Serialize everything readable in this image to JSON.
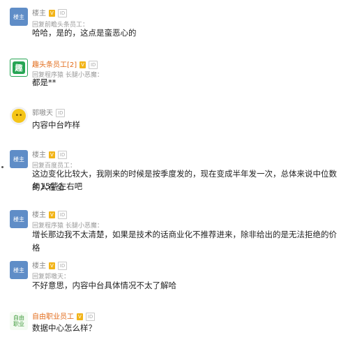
{
  "comments": [
    {
      "avatar_text": "楼主",
      "username": "楼主",
      "badge_v": "V",
      "badge_id": "ID",
      "reply": "回复前瞻头条员工：",
      "content": "哈哈，是的，这点是蛮恶心的"
    },
    {
      "avatar_text": "趣",
      "username": "趣头条员工[2]",
      "badge_v": "V",
      "badge_id": "ID",
      "reply": "回复程序猿 长腿小恶魔：",
      "content": "都是**"
    },
    {
      "avatar_text": "••",
      "username": "郭嗷天",
      "badge_id": "ID",
      "content": "内容中台咋样"
    },
    {
      "avatar_text": "楼主",
      "username": "楼主",
      "badge_v": "V",
      "badge_id": "ID",
      "reply": "回复百度员工：",
      "content_line1": "这边变化比较大，我刚来的时候是按季度发的，现在变成半年发一次，总体来说中位数的人在全",
      "content_line2": "年15薪左右吧"
    },
    {
      "avatar_text": "楼主",
      "username": "楼主",
      "badge_v": "V",
      "badge_id": "ID",
      "reply": "回复程序猿 长腿小恶魔：",
      "content": "增长那边我不太清楚，如果是技术的话商业化不推荐进来，除非给出的是无法拒绝的价格"
    },
    {
      "avatar_text": "楼主",
      "username": "楼主",
      "badge_v": "V",
      "badge_id": "ID",
      "reply": "回复郭嗷天：",
      "content": "不好意思，内容中台具体情况不太了解哈"
    },
    {
      "avatar_text_1": "自由",
      "avatar_text_2": "职业",
      "username": "自由职业员工",
      "badge_v": "V",
      "badge_id": "ID",
      "content": "数据中心怎么样？"
    }
  ]
}
